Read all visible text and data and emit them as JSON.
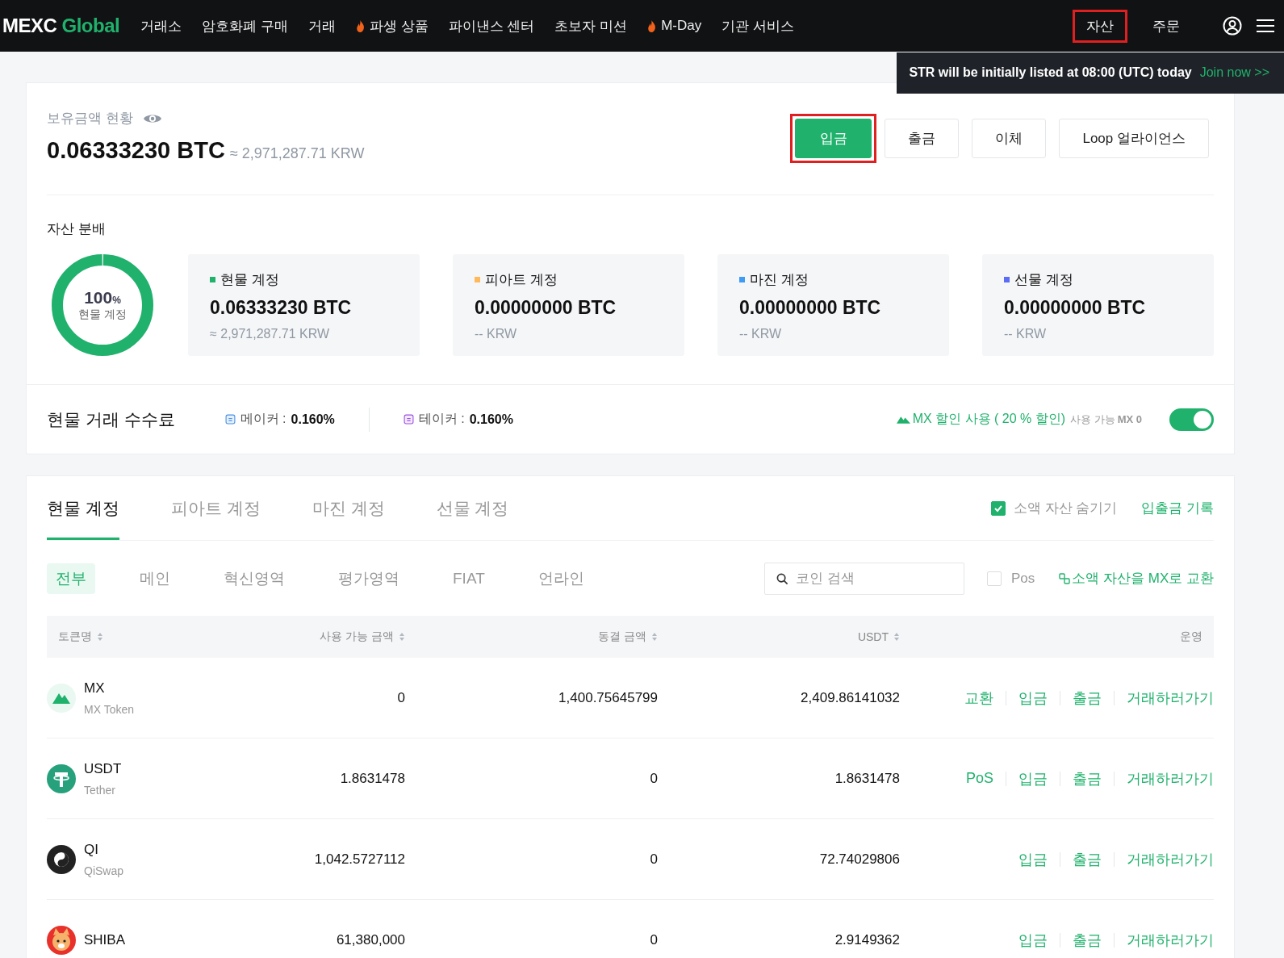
{
  "nav": {
    "logo_main": "MEXC",
    "logo_sub": "Global",
    "items": [
      {
        "label": "거래소",
        "fire": false
      },
      {
        "label": "암호화폐 구매",
        "fire": false
      },
      {
        "label": "거래",
        "fire": false
      },
      {
        "label": "파생 상품",
        "fire": true
      },
      {
        "label": "파이낸스 센터",
        "fire": false
      },
      {
        "label": "초보자 미션",
        "fire": false
      },
      {
        "label": "M-Day",
        "fire": true
      },
      {
        "label": "기관 서비스",
        "fire": false
      }
    ],
    "right_items": [
      {
        "label": "자산",
        "highlighted": true
      },
      {
        "label": "주문",
        "highlighted": false
      }
    ]
  },
  "toast": {
    "text": "STR will be initially listed at 08:00 (UTC) today",
    "link": "Join now >>"
  },
  "overview": {
    "title": "보유금액 현황",
    "amount": "0.06333230 BTC",
    "approx": "≈ 2,971,287.71 KRW",
    "buttons": [
      {
        "label": "입금",
        "kind": "primary",
        "highlighted": true
      },
      {
        "label": "출금",
        "kind": "plain",
        "highlighted": false
      },
      {
        "label": "이체",
        "kind": "plain",
        "highlighted": false
      },
      {
        "label": "Loop 얼라이언스",
        "kind": "plain",
        "highlighted": false
      }
    ]
  },
  "distribution": {
    "title": "자산 분배",
    "center_value": "100",
    "center_unit": "%",
    "center_label": "현물 계정",
    "accounts": [
      {
        "name": "현물 계정",
        "color": "#20b26c",
        "amount": "0.06333230 BTC",
        "fiat": "≈ 2,971,287.71 KRW"
      },
      {
        "name": "피아트 계정",
        "color": "#ffb95b",
        "amount": "0.00000000 BTC",
        "fiat": "-- KRW"
      },
      {
        "name": "마진 계정",
        "color": "#3d9bf5",
        "amount": "0.00000000 BTC",
        "fiat": "-- KRW"
      },
      {
        "name": "선물 계정",
        "color": "#5b6cf5",
        "amount": "0.00000000 BTC",
        "fiat": "-- KRW"
      }
    ]
  },
  "fees": {
    "title": "현물 거래 수수료",
    "maker_label": "메이커 :",
    "maker_value": "0.160%",
    "taker_label": "테이커 :",
    "taker_value": "0.160%",
    "discount": "MX 할인 사용 ( 20 % 할인)",
    "available_label": "사용 가능",
    "available_value": "MX 0",
    "toggle_on": true
  },
  "account_tabs": [
    {
      "label": "현물 계정",
      "selected": true
    },
    {
      "label": "피아트 계정",
      "selected": false
    },
    {
      "label": "마진 계정",
      "selected": false
    },
    {
      "label": "선물 계정",
      "selected": false
    }
  ],
  "hide_small": {
    "label": "소액 자산 숨기기",
    "checked": true
  },
  "history_link": "입출금 기록",
  "filters": [
    {
      "label": "전부",
      "selected": true
    },
    {
      "label": "메인",
      "selected": false
    },
    {
      "label": "혁신영역",
      "selected": false
    },
    {
      "label": "평가영역",
      "selected": false
    },
    {
      "label": "FIAT",
      "selected": false
    },
    {
      "label": "언라인",
      "selected": false
    }
  ],
  "search": {
    "placeholder": "코인 검색"
  },
  "pos_filter": {
    "label": "Pos",
    "checked": false
  },
  "convert_link": "소액 자산을 MX로 교환",
  "table": {
    "columns": [
      {
        "label": "토큰명",
        "sortable": true
      },
      {
        "label": "사용 가능 금액",
        "sortable": true
      },
      {
        "label": "동결 금액",
        "sortable": true
      },
      {
        "label": "USDT",
        "sortable": true
      },
      {
        "label": "운영",
        "sortable": false
      }
    ],
    "rows": [
      {
        "kind": "mx",
        "symbol": "MX",
        "name": "MX Token",
        "available": "0",
        "frozen": "1,400.75645799",
        "usdt": "2,409.86141032",
        "actions": [
          "교환",
          "입금",
          "출금",
          "거래하러가기"
        ]
      },
      {
        "kind": "usdt",
        "symbol": "USDT",
        "name": "Tether",
        "available": "1.8631478",
        "frozen": "0",
        "usdt": "1.8631478",
        "actions": [
          "PoS",
          "입금",
          "출금",
          "거래하러가기"
        ]
      },
      {
        "kind": "qi",
        "symbol": "QI",
        "name": "QiSwap",
        "available": "1,042.5727112",
        "frozen": "0",
        "usdt": "72.74029806",
        "actions": [
          "입금",
          "출금",
          "거래하러가기"
        ]
      },
      {
        "kind": "shiba",
        "symbol": "SHIBA",
        "available": "61,380,000",
        "frozen": "0",
        "usdt": "2.9149362",
        "actions": [
          "입금",
          "출금",
          "거래하러가기"
        ]
      }
    ]
  }
}
